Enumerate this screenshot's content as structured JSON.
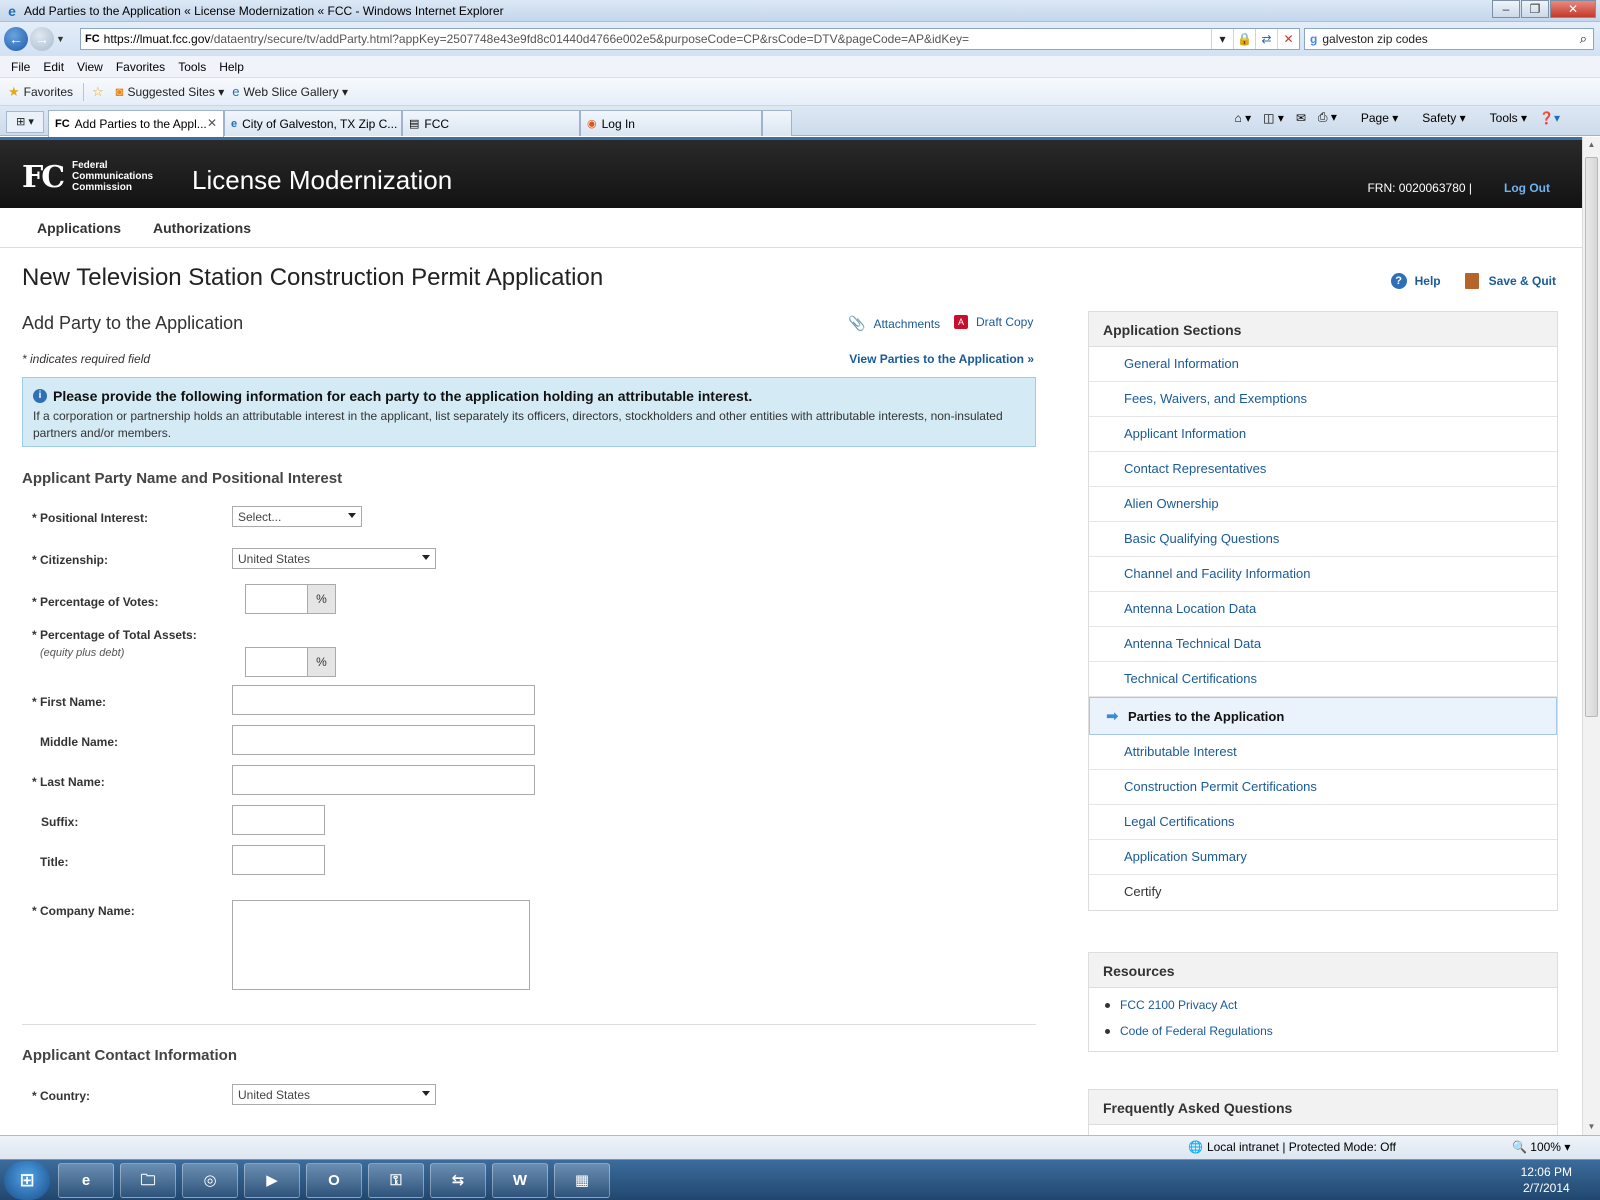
{
  "browser": {
    "window_title": "Add Parties to the Application « License Modernization « FCC - Windows Internet Explorer",
    "url_domain": "https://lmuat.fcc.gov",
    "url_path": "/dataentry/secure/tv/addParty.html?appKey=2507748e43e9fd8c01440d4766e002e5&purposeCode=CP&rsCode=DTV&pageCode=AP&idKey=",
    "search_value": "galveston zip codes",
    "menu": [
      "File",
      "Edit",
      "View",
      "Favorites",
      "Tools",
      "Help"
    ],
    "favorites": {
      "favorites": "Favorites",
      "suggested": "Suggested Sites",
      "webslice": "Web Slice Gallery"
    },
    "tabs": [
      {
        "label": "Add Parties to the Appl..."
      },
      {
        "label": "City of Galveston, TX Zip C..."
      },
      {
        "label": "FCC"
      },
      {
        "label": "Log In"
      }
    ],
    "commands": {
      "page": "Page",
      "safety": "Safety",
      "tools": "Tools"
    },
    "status_zone": "Local intranet | Protected Mode: Off",
    "zoom": "100%"
  },
  "header": {
    "logo_text": "FC",
    "logo_lines": [
      "Federal",
      "Communications",
      "Commission"
    ],
    "app_title": "License Modernization",
    "frn": "FRN: 0020063780  |",
    "logout": "Log Out"
  },
  "topnav": {
    "applications": "Applications",
    "authorizations": "Authorizations"
  },
  "page": {
    "title": "New Television Station Construction Permit Application",
    "help": "Help",
    "save_quit": "Save & Quit",
    "section_title": "Add Party to the Application",
    "attachments": "Attachments",
    "draft_copy": "Draft Copy",
    "required_note": "* indicates required field",
    "view_parties": "View Parties to the Application »",
    "info_heading": "Please provide the following information for each party to the application holding an attributable interest.",
    "info_body": "If a corporation or partnership holds an attributable interest in the applicant, list separately its officers, directors, stockholders and other entities with attributable interests, non-insulated partners and/or members."
  },
  "form": {
    "section1": "Applicant Party Name and Positional Interest",
    "positional_interest_label": "* Positional Interest:",
    "positional_interest_value": "Select...",
    "citizenship_label": "* Citizenship:",
    "citizenship_value": "United States",
    "pct_votes_label": "* Percentage of Votes:",
    "pct_assets_label": "* Percentage of Total Assets:",
    "pct_assets_sub": "(equity plus debt)",
    "pct_symbol": "%",
    "first_name_label": "* First Name:",
    "middle_name_label": "Middle Name:",
    "last_name_label": "* Last Name:",
    "suffix_label": "Suffix:",
    "title_label": "Title:",
    "company_label": "* Company Name:",
    "section2": "Applicant Contact Information",
    "country_label": "* Country:",
    "country_value": "United States"
  },
  "sidebar": {
    "heading": "Application Sections",
    "items": [
      "General Information",
      "Fees, Waivers, and Exemptions",
      "Applicant Information",
      "Contact Representatives",
      "Alien Ownership",
      "Basic Qualifying Questions",
      "Channel and Facility Information",
      "Antenna Location Data",
      "Antenna Technical Data",
      "Technical Certifications",
      "Parties to the Application",
      "Attributable Interest",
      "Construction Permit Certifications",
      "Legal Certifications",
      "Application Summary",
      "Certify"
    ],
    "active_index": 10,
    "resources_heading": "Resources",
    "resources": [
      "FCC 2100 Privacy Act",
      "Code of Federal Regulations"
    ],
    "faq_heading": "Frequently Asked Questions"
  },
  "taskbar": {
    "time": "12:06 PM",
    "date": "2/7/2014"
  },
  "colors": {
    "link": "#1a5a96",
    "header_bg": "#1a1a1a",
    "info_bg": "#d4ebf5",
    "active_item_bg": "#eaf3fb"
  }
}
